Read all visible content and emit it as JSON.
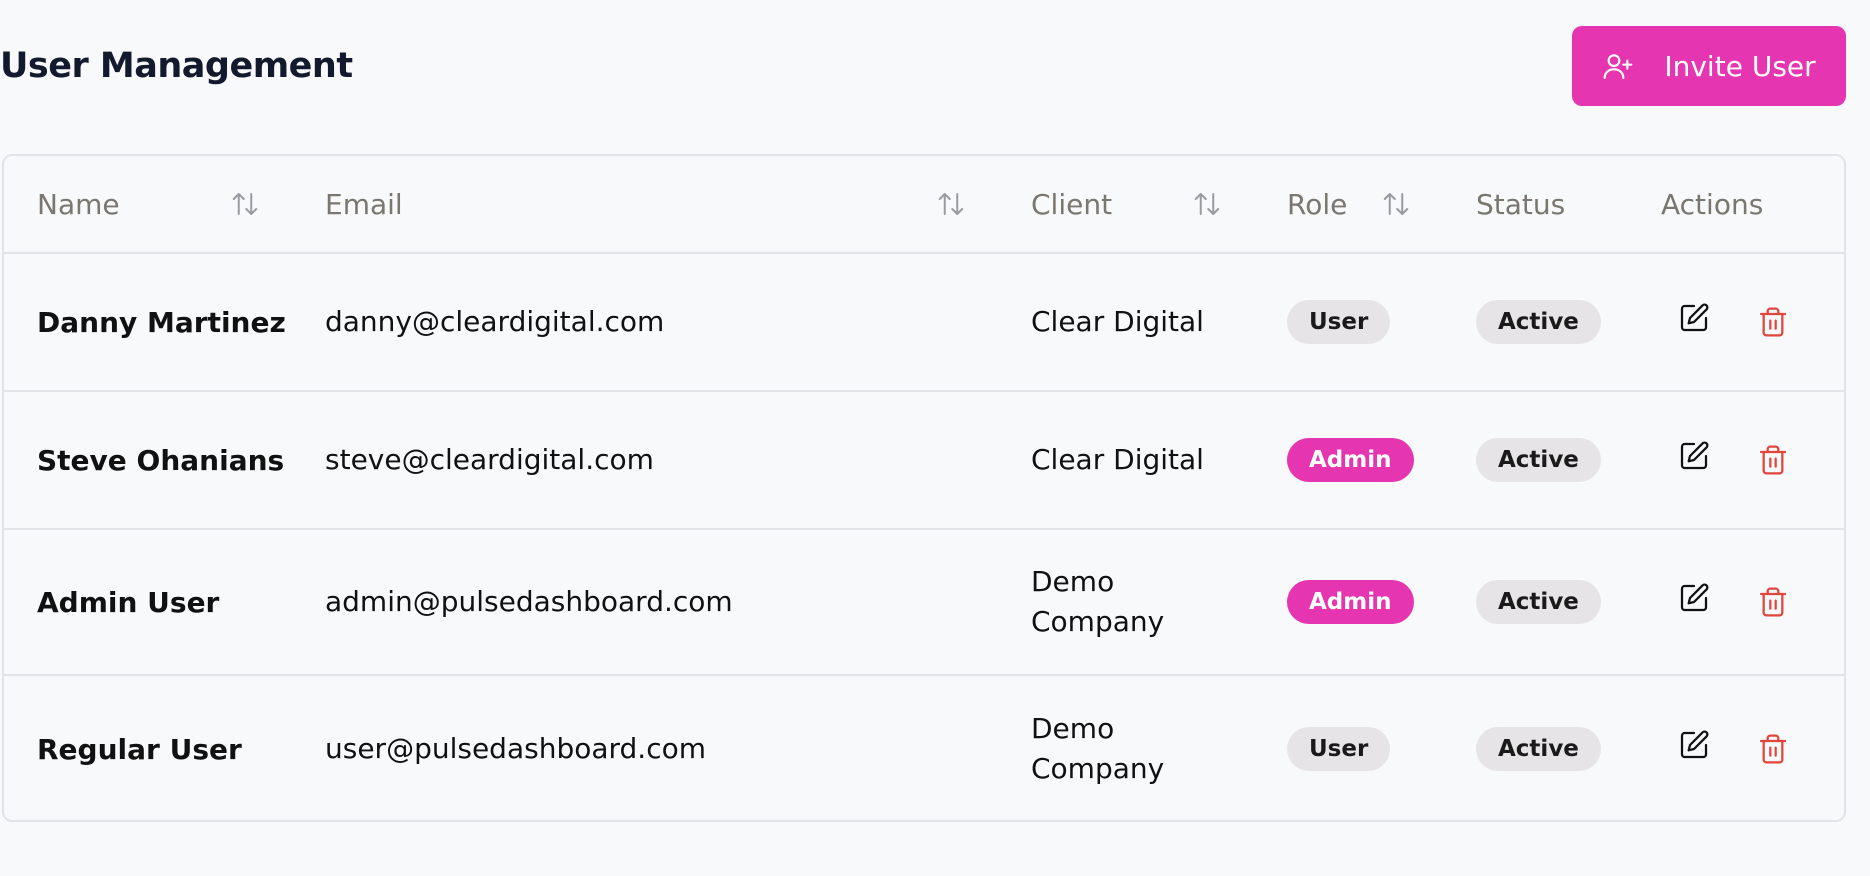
{
  "header": {
    "title": "User Management",
    "invite_label": "Invite User"
  },
  "table": {
    "columns": [
      "Name",
      "Email",
      "Client",
      "Role",
      "Status",
      "Actions"
    ],
    "rows": [
      {
        "name": "Danny Martinez",
        "email": "danny@cleardigital.com",
        "client": "Clear Digital",
        "role": "User",
        "status": "Active"
      },
      {
        "name": "Steve Ohanians",
        "email": "steve@cleardigital.com",
        "client": "Clear Digital",
        "role": "Admin",
        "status": "Active"
      },
      {
        "name": "Admin User",
        "email": "admin@pulsedashboard.com",
        "client": "Demo Company",
        "role": "Admin",
        "status": "Active"
      },
      {
        "name": "Regular User",
        "email": "user@pulsedashboard.com",
        "client": "Demo Company",
        "role": "User",
        "status": "Active"
      }
    ]
  },
  "colors": {
    "accent": "#e535b1",
    "delete": "#e0463c"
  },
  "icons": {
    "invite": "user-plus-icon",
    "sort": "sort-arrows-icon",
    "edit": "edit-icon",
    "delete": "trash-icon"
  }
}
